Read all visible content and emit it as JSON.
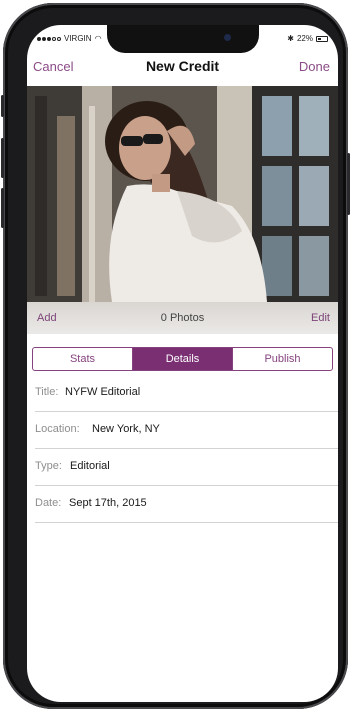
{
  "status": {
    "carrier": "VIRGIN",
    "battery": "22%"
  },
  "nav": {
    "cancel": "Cancel",
    "title": "New Credit",
    "done": "Done"
  },
  "photos": {
    "add": "Add",
    "count": "0 Photos",
    "edit": "Edit"
  },
  "tabs": [
    {
      "label": "Stats",
      "active": false
    },
    {
      "label": "Details",
      "active": true
    },
    {
      "label": "Publish",
      "active": false
    }
  ],
  "fields": [
    {
      "label": "Title:",
      "value": "NYFW Editorial"
    },
    {
      "label": "Location:",
      "value": "New York, NY"
    },
    {
      "label": "Type:",
      "value": "Editorial"
    },
    {
      "label": "Date:",
      "value": "Sept 17th, 2015"
    }
  ],
  "colors": {
    "accent": "#86427f",
    "active_tab": "#7a2f73"
  }
}
